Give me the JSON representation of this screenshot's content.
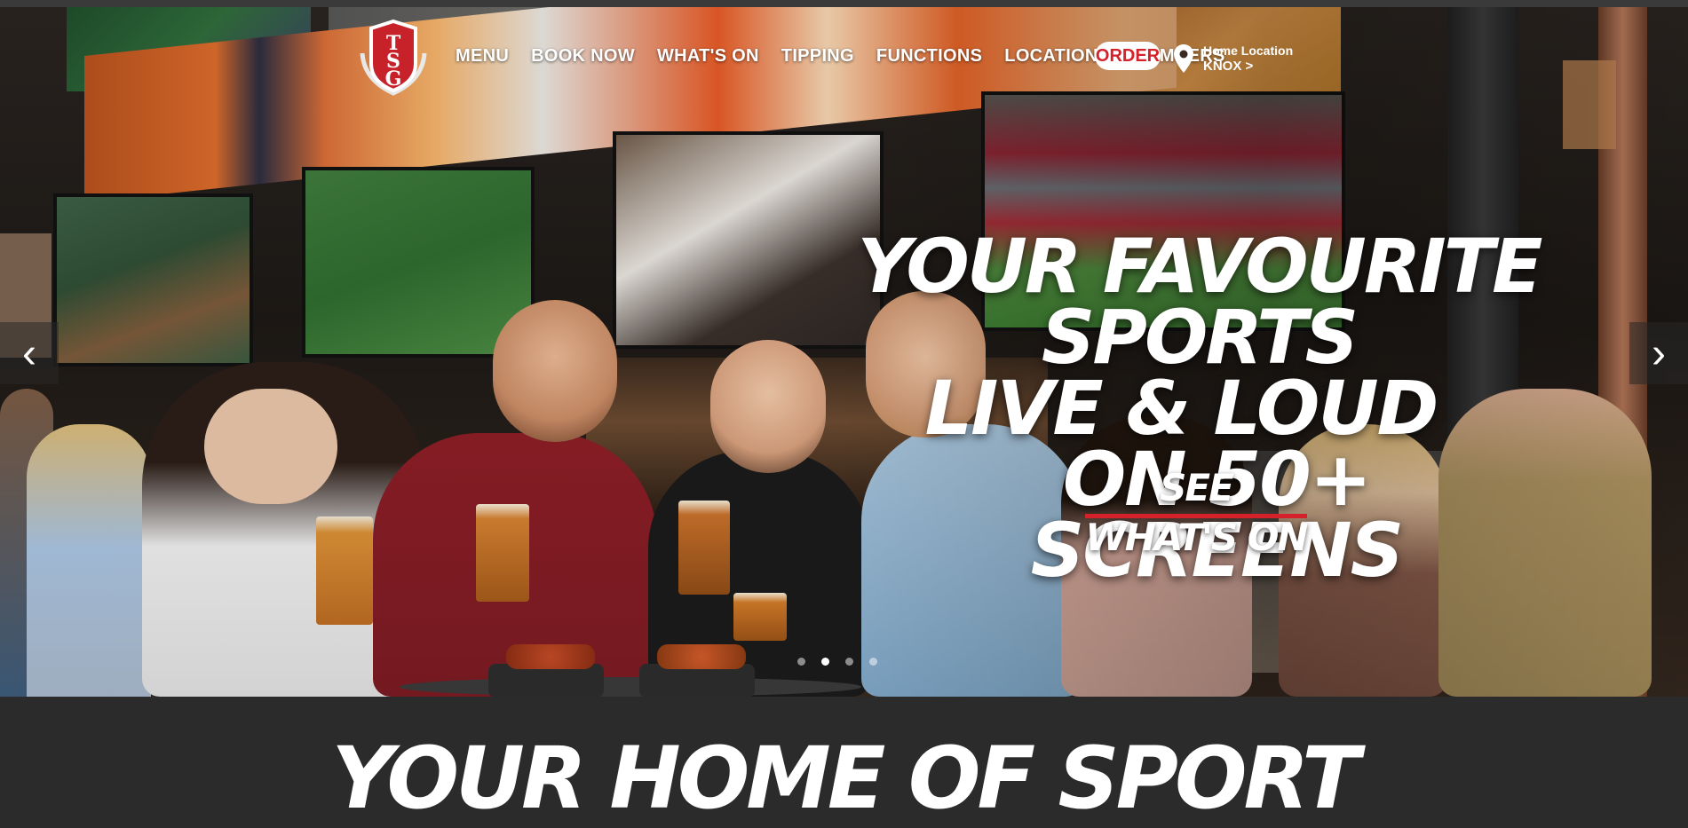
{
  "brand": {
    "logo_letters": "TSG"
  },
  "nav": {
    "items": [
      {
        "label": "MENU"
      },
      {
        "label": "BOOK NOW"
      },
      {
        "label": "WHAT'S ON"
      },
      {
        "label": "TIPPING"
      },
      {
        "label": "FUNCTIONS"
      },
      {
        "label": "LOCATIONS"
      },
      {
        "label": "MEMBERS"
      }
    ],
    "order_label": "ORDER",
    "location": {
      "caption": "Home Location",
      "value": "KNOX >"
    }
  },
  "hero": {
    "headline_lines": [
      "YOUR FAVOURITE SPORTS",
      "LIVE & LOUD",
      "ON 50+ SCREENS"
    ],
    "cta": "SEE WHAT'S ON",
    "prev_arrow": "‹",
    "next_arrow": "›",
    "slide_count": 4,
    "active_slide": 2
  },
  "section": {
    "title": "YOUR HOME OF SPORT"
  },
  "colors": {
    "accent": "#d4212a",
    "background": "#2b2b2b",
    "text": "#ffffff"
  }
}
